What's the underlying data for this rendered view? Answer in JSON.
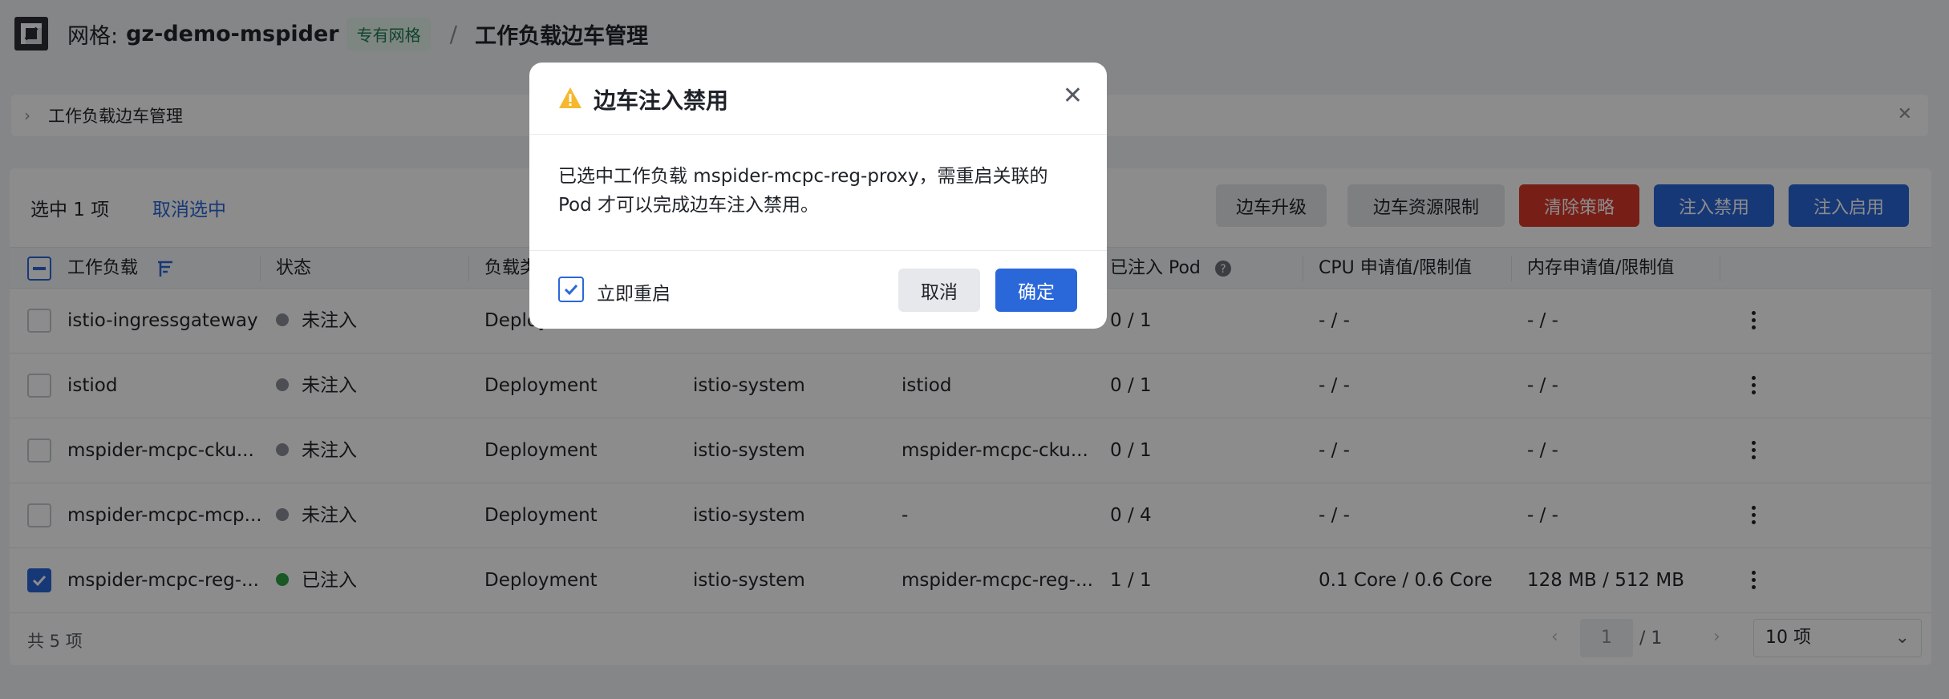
{
  "header": {
    "mesh_prefix": "网格:",
    "mesh_name": "gz-demo-mspider",
    "mesh_tag": "专有网格",
    "separator": "/",
    "current_page": "工作负载边车管理"
  },
  "collapse": {
    "title": "工作负载边车管理"
  },
  "toolbar": {
    "selected_text": "选中 1 项",
    "clear_selection": "取消选中",
    "buttons": [
      "边车升级",
      "边车资源限制",
      "清除策略",
      "注入禁用",
      "注入启用"
    ]
  },
  "table": {
    "headers": [
      "工作负载",
      "状态",
      "负载类",
      "",
      "",
      "已注入 Pod",
      "CPU 申请值/限制值",
      "内存申请值/限制值"
    ],
    "rows": [
      {
        "name": "istio-ingressgateway",
        "status": "未注入",
        "status_color": "#8a8f99",
        "type": "Deploy",
        "namespace": "",
        "label": "...",
        "pods": "0 / 1",
        "cpu": "- / -",
        "mem": "- / -",
        "checked": false
      },
      {
        "name": "istiod",
        "status": "未注入",
        "status_color": "#8a8f99",
        "type": "Deployment",
        "namespace": "istio-system",
        "label": "istiod",
        "pods": "0 / 1",
        "cpu": "- / -",
        "mem": "- / -",
        "checked": false
      },
      {
        "name": "mspider-mcpc-cku...",
        "status": "未注入",
        "status_color": "#8a8f99",
        "type": "Deployment",
        "namespace": "istio-system",
        "label": "mspider-mcpc-cku...",
        "pods": "0 / 1",
        "cpu": "- / -",
        "mem": "- / -",
        "checked": false
      },
      {
        "name": "mspider-mcpc-mcp...",
        "status": "未注入",
        "status_color": "#8a8f99",
        "type": "Deployment",
        "namespace": "istio-system",
        "label": "-",
        "pods": "0 / 4",
        "cpu": "- / -",
        "mem": "- / -",
        "checked": false
      },
      {
        "name": "mspider-mcpc-reg-...",
        "status": "已注入",
        "status_color": "#2ea043",
        "type": "Deployment",
        "namespace": "istio-system",
        "label": "mspider-mcpc-reg-...",
        "pods": "1 / 1",
        "cpu": "0.1 Core / 0.6 Core",
        "mem": "128 MB / 512 MB",
        "checked": true
      }
    ]
  },
  "footer": {
    "total": "共 5 项",
    "page": "1",
    "page_total": "/ 1",
    "page_size": "10 项"
  },
  "modal": {
    "title": "边车注入禁用",
    "body": "已选中工作负载 mspider-mcpc-reg-proxy，需重启关联的 Pod 才可以完成边车注入禁用。",
    "restart_label": "立即重启",
    "restart_checked": true,
    "cancel": "取消",
    "confirm": "确定"
  },
  "colors": {
    "primary": "#2a67d9",
    "danger": "#d9392b",
    "warning": "#f5b82e",
    "success": "#2ea043"
  }
}
